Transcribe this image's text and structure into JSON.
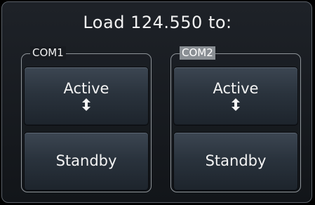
{
  "dialog": {
    "title": "Load 124.550 to:"
  },
  "groups": [
    {
      "label": "COM1",
      "selected": false,
      "active_label": "Active",
      "active_icon": "swap-arrow-icon",
      "standby_label": "Standby"
    },
    {
      "label": "COM2",
      "selected": true,
      "active_label": "Active",
      "active_icon": "swap-arrow-icon",
      "standby_label": "Standby"
    }
  ],
  "colors": {
    "background": "#000000",
    "dialog_border": "#5a6068",
    "button_top": "#3c4652",
    "button_bottom": "#1d242c",
    "text": "#f4f4f4",
    "selected_label_bg": "#8a8f94"
  }
}
